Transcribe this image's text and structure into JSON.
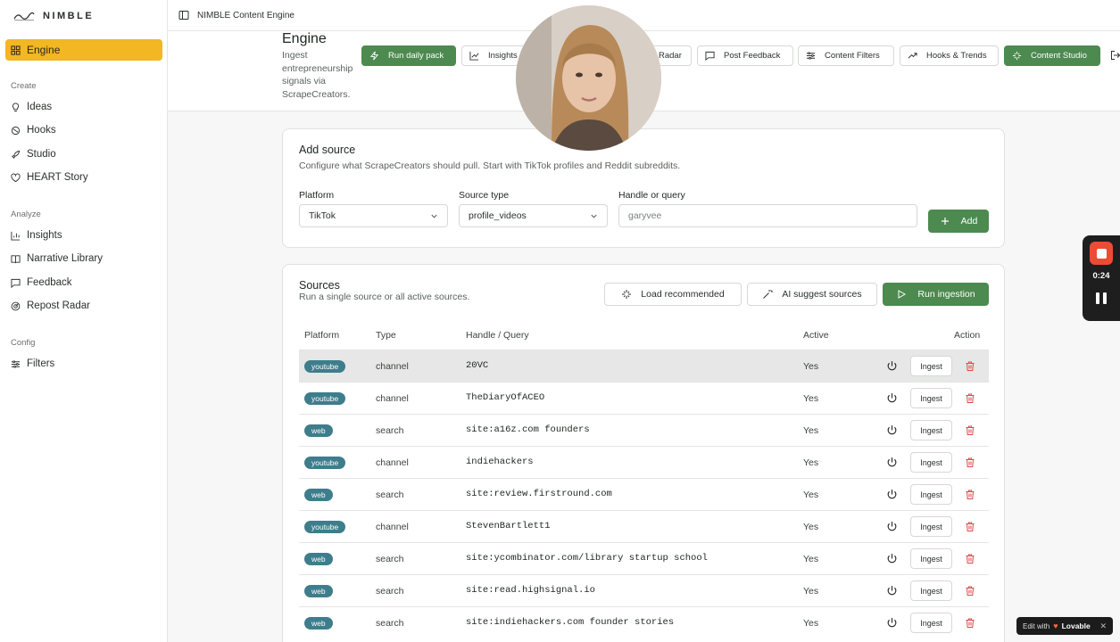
{
  "brand": {
    "name": "NIMBLE"
  },
  "topbar": {
    "title": "NIMBLE Content Engine"
  },
  "sidebar": {
    "active": {
      "label": "Engine",
      "icon": "grid-icon"
    },
    "sections": [
      {
        "label": "Create",
        "items": [
          {
            "label": "Ideas",
            "icon": "lightbulb-icon"
          },
          {
            "label": "Hooks",
            "icon": "hooks-icon"
          },
          {
            "label": "Studio",
            "icon": "rocket-icon"
          },
          {
            "label": "HEART Story",
            "icon": "heart-icon"
          }
        ]
      },
      {
        "label": "Analyze",
        "items": [
          {
            "label": "Insights",
            "icon": "bar-chart-icon"
          },
          {
            "label": "Narrative Library",
            "icon": "book-icon"
          },
          {
            "label": "Feedback",
            "icon": "message-icon"
          },
          {
            "label": "Repost Radar",
            "icon": "radar-icon"
          }
        ]
      },
      {
        "label": "Config",
        "items": [
          {
            "label": "Filters",
            "icon": "sliders-icon"
          }
        ]
      }
    ]
  },
  "header": {
    "title": "Engine",
    "description": "Ingest entrepreneurship signals via ScrapeCreators.",
    "buttons": [
      {
        "label": "Run daily pack",
        "icon": "zap-icon",
        "primary": true
      },
      {
        "label": "Insights",
        "icon": "line-chart-icon"
      },
      {
        "label": "Radar",
        "icon": "radar-icon"
      },
      {
        "label": "Post Feedback",
        "icon": "message-icon"
      },
      {
        "label": "Content Filters",
        "icon": "sliders-icon"
      },
      {
        "label": "Hooks & Trends",
        "icon": "trending-icon"
      },
      {
        "label": "Content Studio",
        "icon": "sparkles-icon",
        "primary": true
      }
    ]
  },
  "add_source": {
    "title": "Add source",
    "subtitle": "Configure what ScrapeCreators should pull. Start with TikTok profiles and Reddit subreddits.",
    "platform_label": "Platform",
    "platform_value": "TikTok",
    "source_type_label": "Source type",
    "source_type_value": "profile_videos",
    "handle_label": "Handle or query",
    "handle_placeholder": "garyvee",
    "add_button": "Add"
  },
  "sources": {
    "title": "Sources",
    "subtitle": "Run a single source or all active sources.",
    "load_recommended": "Load recommended",
    "ai_suggest": "AI suggest sources",
    "run_ingestion": "Run ingestion",
    "columns": [
      "Platform",
      "Type",
      "Handle / Query",
      "Active",
      "Action"
    ],
    "ingest_label": "Ingest",
    "rows": [
      {
        "platform": "youtube",
        "type": "channel",
        "handle": "20VC",
        "active": "Yes"
      },
      {
        "platform": "youtube",
        "type": "channel",
        "handle": "TheDiaryOfACEO",
        "active": "Yes"
      },
      {
        "platform": "web",
        "type": "search",
        "handle": "site:a16z.com founders",
        "active": "Yes"
      },
      {
        "platform": "youtube",
        "type": "channel",
        "handle": "indiehackers",
        "active": "Yes"
      },
      {
        "platform": "web",
        "type": "search",
        "handle": "site:review.firstround.com",
        "active": "Yes"
      },
      {
        "platform": "youtube",
        "type": "channel",
        "handle": "StevenBartlett1",
        "active": "Yes"
      },
      {
        "platform": "web",
        "type": "search",
        "handle": "site:ycombinator.com/library startup school",
        "active": "Yes"
      },
      {
        "platform": "web",
        "type": "search",
        "handle": "site:read.highsignal.io",
        "active": "Yes"
      },
      {
        "platform": "web",
        "type": "search",
        "handle": "site:indiehackers.com founder stories",
        "active": "Yes"
      }
    ]
  },
  "recorder": {
    "time": "0:24"
  },
  "lovable": {
    "prefix": "Edit with",
    "name": "Lovable"
  },
  "colors": {
    "accent": "#f2b722",
    "primary_green": "#4c8a4f",
    "badge": "#3e7d8c",
    "danger": "#e04848"
  }
}
